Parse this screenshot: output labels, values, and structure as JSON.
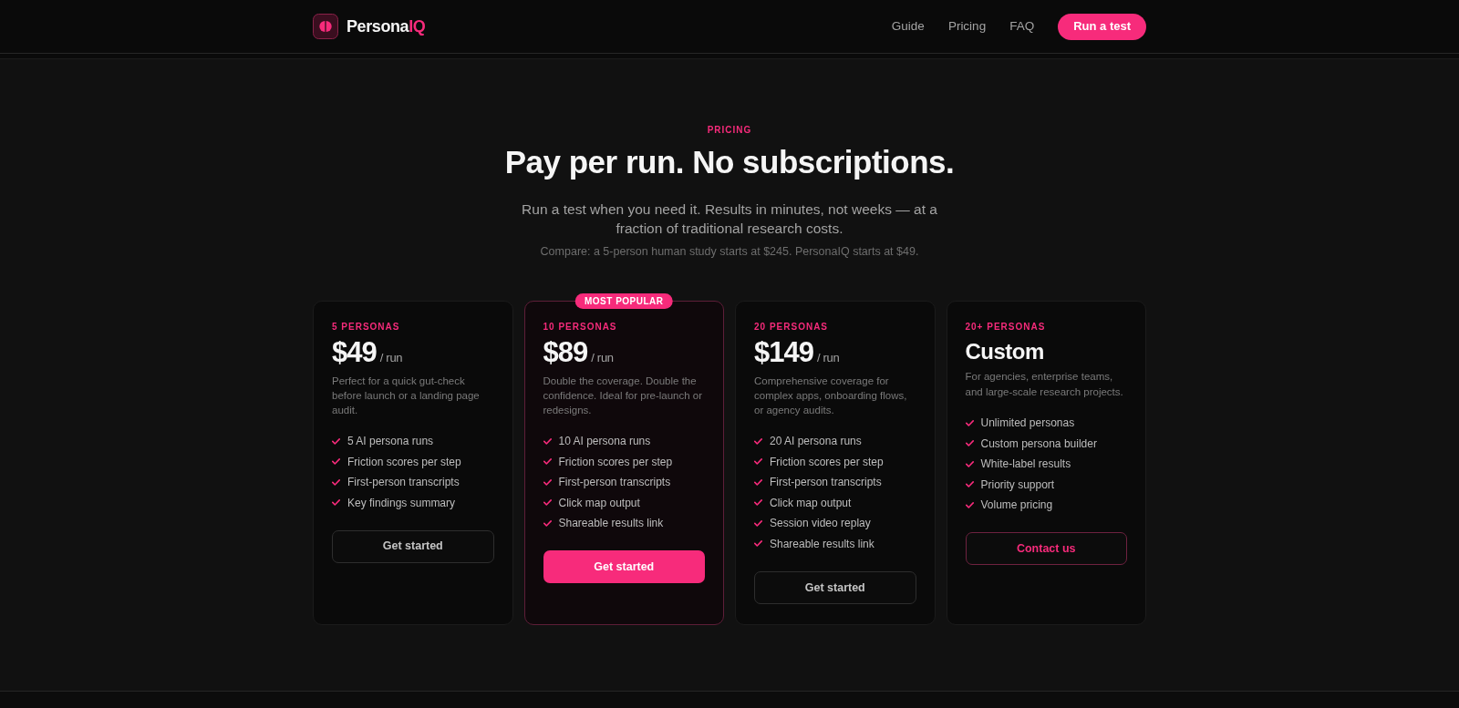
{
  "header": {
    "logo": {
      "text": "Persona",
      "accent": "IQ"
    },
    "nav": [
      {
        "label": "Guide"
      },
      {
        "label": "Pricing"
      },
      {
        "label": "FAQ"
      }
    ],
    "cta": "Run a test"
  },
  "hero": {
    "eyebrow": "PRICING",
    "title": "Pay per run. No subscriptions.",
    "subtitle": "Run a test when you need it. Results in minutes, not weeks — at a fraction of traditional research costs.",
    "note": "Compare: a 5-person human study starts at $245. PersonaIQ starts at $49."
  },
  "cards": [
    {
      "kind": "priced",
      "highlighted": false,
      "label": "5 PERSONAS",
      "price": "$49",
      "unit": "/ run",
      "description": "Perfect for a quick gut-check before launch or a landing page audit.",
      "features": [
        "5 AI persona runs",
        "Friction scores per step",
        "First-person transcripts",
        "Key findings summary"
      ],
      "button": {
        "label": "Get started",
        "kind": "outline"
      }
    },
    {
      "kind": "priced",
      "highlighted": true,
      "badge": "MOST POPULAR",
      "label": "10 PERSONAS",
      "price": "$89",
      "unit": "/ run",
      "description": "Double the coverage. Double the confidence. Ideal for pre-launch or redesigns.",
      "features": [
        "10 AI persona runs",
        "Friction scores per step",
        "First-person transcripts",
        "Click map output",
        "Shareable results link"
      ],
      "button": {
        "label": "Get started",
        "kind": "filled"
      }
    },
    {
      "kind": "priced",
      "highlighted": false,
      "label": "20 PERSONAS",
      "price": "$149",
      "unit": "/ run",
      "description": "Comprehensive coverage for complex apps, onboarding flows, or agency audits.",
      "features": [
        "20 AI persona runs",
        "Friction scores per step",
        "First-person transcripts",
        "Click map output",
        "Session video replay",
        "Shareable results link"
      ],
      "button": {
        "label": "Get started",
        "kind": "outline"
      }
    },
    {
      "kind": "custom",
      "highlighted": false,
      "label": "20+ PERSONAS",
      "title": "Custom",
      "description": "For agencies, enterprise teams, and large-scale research projects.",
      "features": [
        "Unlimited personas",
        "Custom persona builder",
        "White-label results",
        "Priority support",
        "Volume pricing"
      ],
      "button": {
        "label": "Contact us",
        "kind": "accent"
      }
    }
  ]
}
